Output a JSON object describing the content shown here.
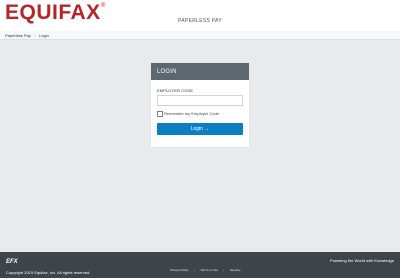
{
  "header": {
    "logo_text": "EQUIFAX",
    "logo_mark": "®",
    "app_title": "PAPERLESS PAY"
  },
  "breadcrumb": {
    "items": [
      "Paperless Pay",
      "Login"
    ],
    "separator": "›"
  },
  "login_card": {
    "title": "LOGIN",
    "employer_code_label": "EMPLOYER CODE",
    "employer_code_value": "",
    "employer_code_placeholder": "",
    "remember_label": "Remember my Employer Code",
    "remember_checked": false,
    "login_button_label": "Login →"
  },
  "footer": {
    "brand": "EFX",
    "copyright": "Copyright 2019 Equifax, Inc. All rights reserved.",
    "links": [
      "Privacy Policy",
      "Terms of Use",
      "Security"
    ],
    "link_separator": "|",
    "tagline": "Powering the World with Knowledge"
  },
  "colors": {
    "brand_red": "#b5252b",
    "card_header": "#5c6770",
    "primary_button": "#0b7fc2",
    "footer_bg": "#3f4449",
    "page_bg": "#e8ebed"
  }
}
